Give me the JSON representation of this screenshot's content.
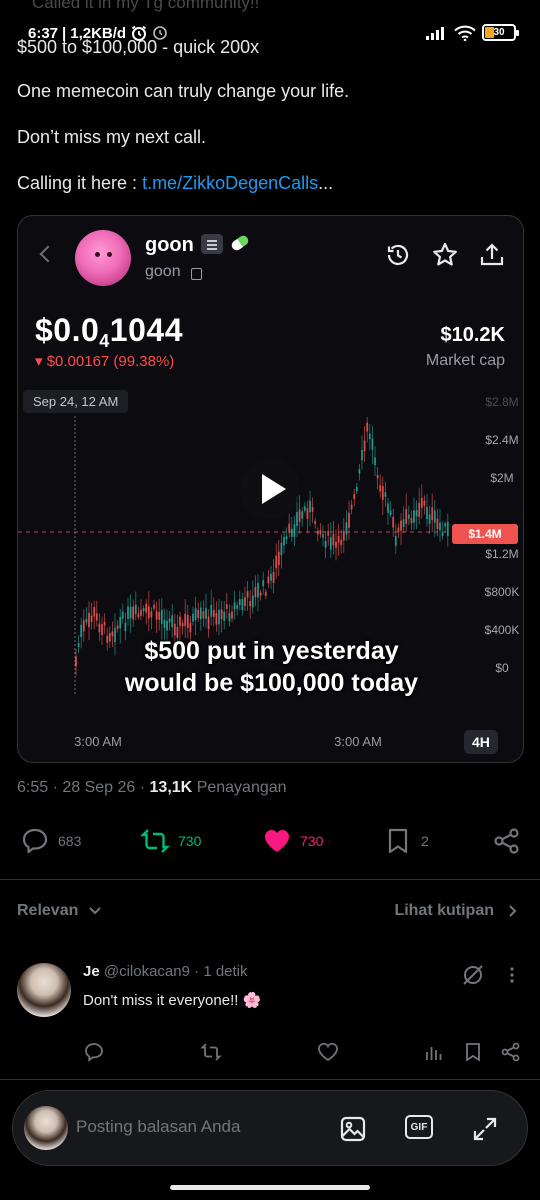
{
  "status_bar": {
    "overlap_text": "Called it in my Tg community!!",
    "time": "6:37",
    "speed": "1,2KB/d",
    "battery": "30"
  },
  "tweet": {
    "line1": "$500 to $100,000 - quick 200x",
    "line2": "One memecoin can truly change your life.",
    "line3": "Don’t miss my next call.",
    "line4_prefix": "Calling it here : ",
    "line4_link": "t.me/ZikkoDegenCalls",
    "line4_suffix": "..."
  },
  "media": {
    "token_name": "goon",
    "token_symbol": "goon",
    "price_prefix": "$0.0",
    "price_sub": "4",
    "price_rest": "1044",
    "price_change": "▾ $0.00167 (99.38%)",
    "market_cap_value": "$10.2K",
    "market_cap_label": "Market cap",
    "date_label": "Sep 24, 12 AM",
    "caption_line1": "$500 put in yesterday",
    "caption_line2": "would be $100,000 today",
    "timeframe": "4H",
    "current_price_tag": "$1.4M",
    "y_ticks": [
      "$2.8M",
      "$2.4M",
      "$2M",
      "$1.2M",
      "$800K",
      "$400K",
      "$0"
    ],
    "x_ticks": [
      "3:00 AM",
      "3:00 AM"
    ],
    "accent_green": "#26a69a",
    "accent_red": "#ef5350"
  },
  "meta": {
    "time": "6:55",
    "date": "28 Sep 26",
    "views_count": "13,1K",
    "views_label": "Penayangan"
  },
  "actions": {
    "replies": "683",
    "reposts": "730",
    "likes": "730",
    "bookmarks": "2"
  },
  "sort": {
    "left_label": "Relevan",
    "right_label": "Lihat kutipan"
  },
  "reply": {
    "name": "Je",
    "handle": "@cilokacan9",
    "time": "1 detik",
    "body": "Don't miss it everyone!! 🌸"
  },
  "compose": {
    "placeholder": "Posting balasan Anda",
    "gif_label": "GIF"
  }
}
